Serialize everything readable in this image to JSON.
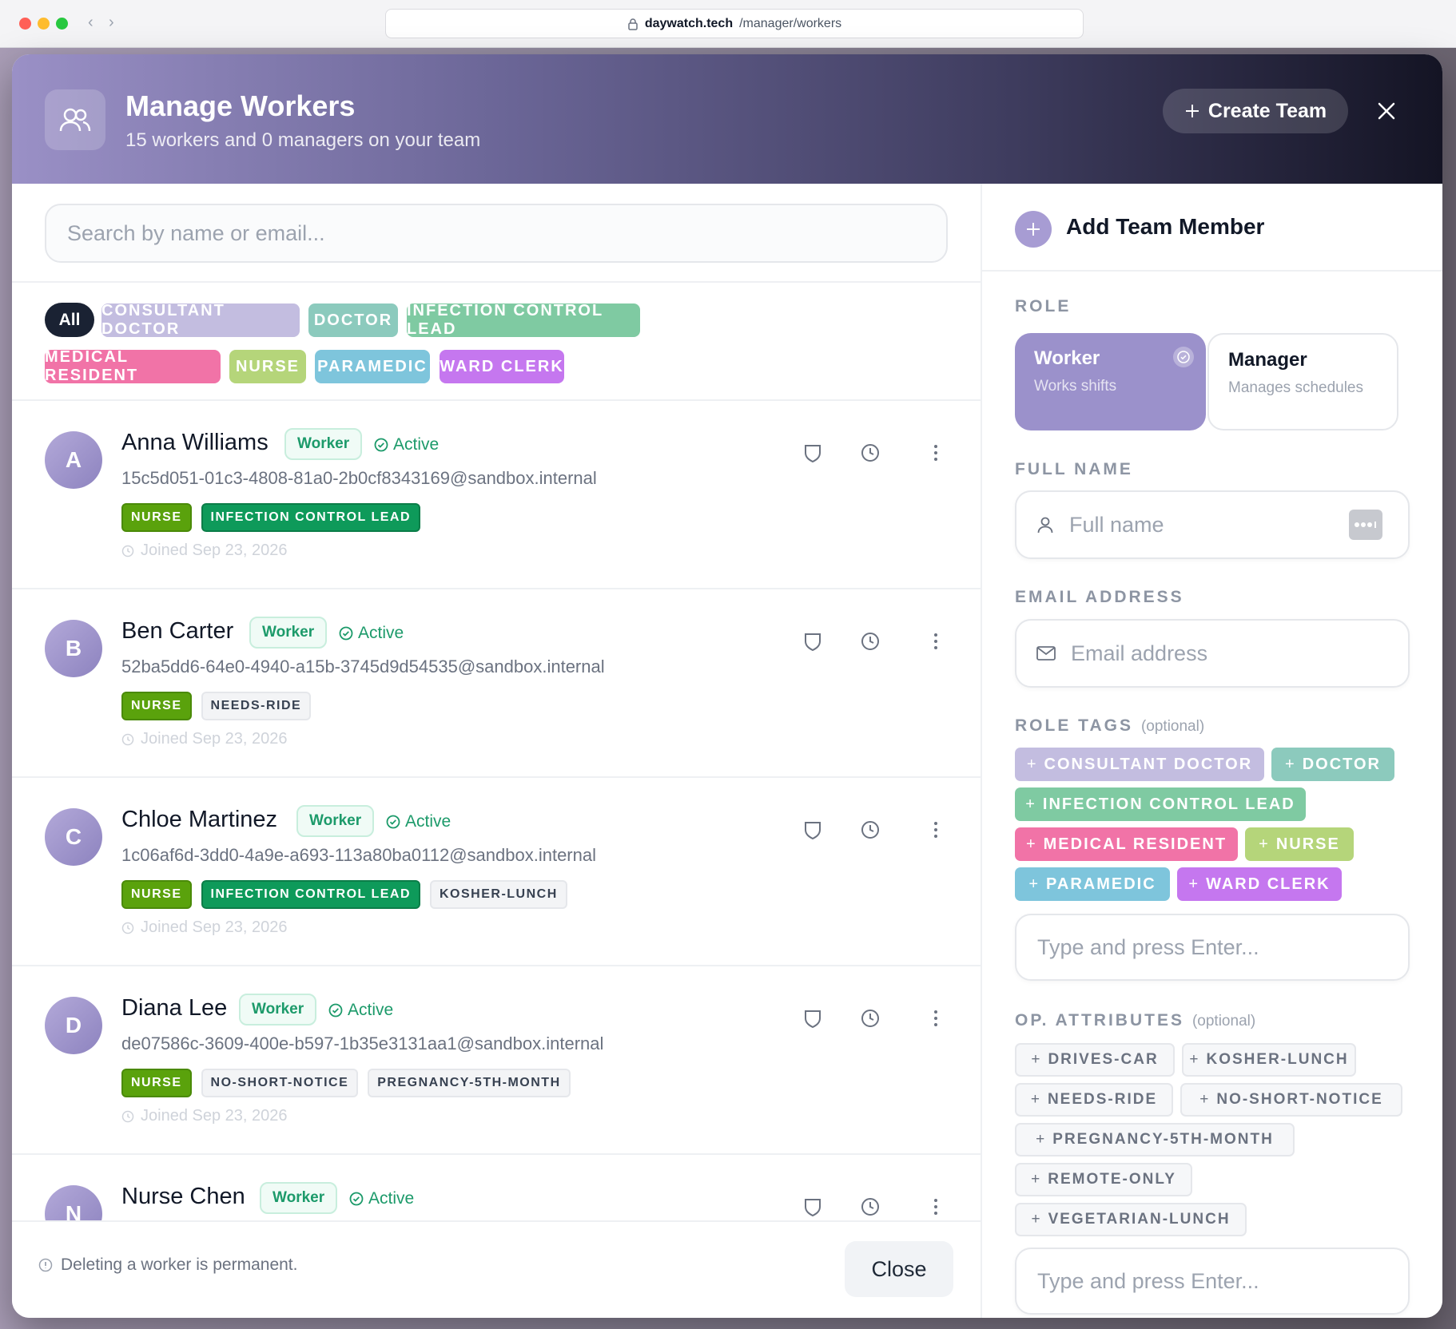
{
  "browser": {
    "host": "daywatch.tech",
    "path": "/manager/workers"
  },
  "header": {
    "title": "Manage Workers",
    "subtitle": "15 workers and 0 managers on your team",
    "create_team": "Create Team"
  },
  "search": {
    "placeholder": "Search by name or email..."
  },
  "filters": [
    "All",
    "CONSULTANT DOCTOR",
    "DOCTOR",
    "INFECTION CONTROL LEAD",
    "MEDICAL RESIDENT",
    "NURSE",
    "PARAMEDIC",
    "WARD CLERK"
  ],
  "filter_colors": [
    "#1a2233",
    "#c3bde0",
    "#8ccabd",
    "#7fcaa2",
    "#f173a7",
    "#b5d57a",
    "#7ec5dc",
    "#c577ef"
  ],
  "workers": [
    {
      "initial": "A",
      "name": "Anna Williams",
      "role": "Worker",
      "status": "Active",
      "email": "15c5d051-01c3-4808-81a0-2b0cf8343169@sandbox.internal",
      "tags": [
        "NURSE",
        "INFECTION CONTROL LEAD"
      ],
      "tag_kinds": [
        "nurse",
        "icl"
      ],
      "joined": "Joined Sep 23, 2026"
    },
    {
      "initial": "B",
      "name": "Ben Carter",
      "role": "Worker",
      "status": "Active",
      "email": "52ba5dd6-64e0-4940-a15b-3745d9d54535@sandbox.internal",
      "tags": [
        "NURSE",
        "NEEDS-RIDE"
      ],
      "tag_kinds": [
        "nurse",
        "op"
      ],
      "joined": "Joined Sep 23, 2026"
    },
    {
      "initial": "C",
      "name": "Chloe Martinez",
      "role": "Worker",
      "status": "Active",
      "email": "1c06af6d-3dd0-4a9e-a693-113a80ba0112@sandbox.internal",
      "tags": [
        "NURSE",
        "INFECTION CONTROL LEAD",
        "KOSHER-LUNCH"
      ],
      "tag_kinds": [
        "nurse",
        "icl",
        "op"
      ],
      "joined": "Joined Sep 23, 2026"
    },
    {
      "initial": "D",
      "name": "Diana Lee",
      "role": "Worker",
      "status": "Active",
      "email": "de07586c-3609-400e-b597-1b35e3131aa1@sandbox.internal",
      "tags": [
        "NURSE",
        "NO-SHORT-NOTICE",
        "PREGNANCY-5TH-MONTH"
      ],
      "tag_kinds": [
        "nurse",
        "op",
        "op"
      ],
      "joined": "Joined Sep 23, 2026"
    },
    {
      "initial": "N",
      "name": "Nurse Chen",
      "role": "Worker",
      "status": "Active",
      "email": "",
      "tags": [],
      "tag_kinds": [],
      "joined": ""
    }
  ],
  "footer": {
    "note": "Deleting a worker is permanent.",
    "close": "Close"
  },
  "add_member": {
    "title": "Add Team Member",
    "role_label": "ROLE",
    "roles": [
      {
        "title": "Worker",
        "desc": "Works shifts",
        "selected": true
      },
      {
        "title": "Manager",
        "desc": "Manages schedules",
        "selected": false
      }
    ],
    "full_name_label": "FULL NAME",
    "full_name_placeholder": "Full name",
    "email_label": "EMAIL ADDRESS",
    "email_placeholder": "Email address",
    "role_tags_label": "ROLE TAGS",
    "role_tags_optional": "(optional)",
    "role_tags": [
      "CONSULTANT DOCTOR",
      "DOCTOR",
      "INFECTION CONTROL LEAD",
      "MEDICAL RESIDENT",
      "NURSE",
      "PARAMEDIC",
      "WARD CLERK"
    ],
    "role_tag_colors": [
      "#c3bde0",
      "#8ccabd",
      "#7fcaa2",
      "#f173a7",
      "#b5d57a",
      "#7ec5dc",
      "#c577ef"
    ],
    "role_tags_input_placeholder": "Type and press Enter...",
    "op_label": "OP. ATTRIBUTES",
    "op_optional": "(optional)",
    "op_attributes": [
      "DRIVES-CAR",
      "KOSHER-LUNCH",
      "NEEDS-RIDE",
      "NO-SHORT-NOTICE",
      "PREGNANCY-5TH-MONTH",
      "REMOTE-ONLY",
      "VEGETARIAN-LUNCH"
    ],
    "op_input_placeholder": "Type and press Enter..."
  }
}
